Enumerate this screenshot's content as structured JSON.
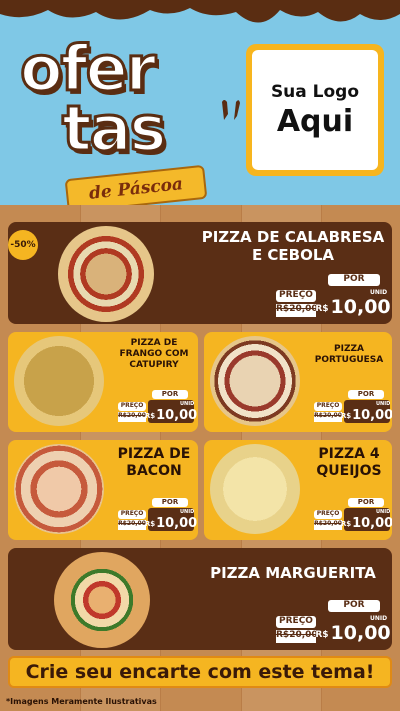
{
  "header": {
    "title_line1": "ofer",
    "title_line2": "tas",
    "subtitle": "de Páscoa",
    "logo_line1": "Sua Logo",
    "logo_line2": "Aqui"
  },
  "discount_badge": "-50%",
  "products": [
    {
      "name": "PIZZA DE CALABRESA E CEBOLA",
      "por_label": "POR",
      "preco_label": "PREÇO",
      "old_price": "R$20,00",
      "currency": "R$",
      "new_price": "10,00",
      "unit": "UNID"
    },
    {
      "name": "PIZZA DE FRANGO COM CATUPIRY",
      "por_label": "POR",
      "preco_label": "PREÇO",
      "old_price": "R$20,00",
      "currency": "R$",
      "new_price": "10,00",
      "unit": "UNID"
    },
    {
      "name": "PIZZA PORTUGUESA",
      "por_label": "POR",
      "preco_label": "PREÇO",
      "old_price": "R$20,00",
      "currency": "R$",
      "new_price": "10,00",
      "unit": "UNID"
    },
    {
      "name": "PIZZA DE BACON",
      "por_label": "POR",
      "preco_label": "PREÇO",
      "old_price": "R$20,00",
      "currency": "R$",
      "new_price": "10,00",
      "unit": "UNID"
    },
    {
      "name": "PIZZA 4 QUEIJOS",
      "por_label": "POR",
      "preco_label": "PREÇO",
      "old_price": "R$20,00",
      "currency": "R$",
      "new_price": "10,00",
      "unit": "UNID"
    },
    {
      "name": "PIZZA MARGUERITA",
      "por_label": "POR",
      "preco_label": "PREÇO",
      "old_price": "R$20,00",
      "currency": "R$",
      "new_price": "10,00",
      "unit": "UNID"
    }
  ],
  "cta": "Crie seu encarte com este tema!",
  "footnote": "*Imagens Meramente Ilustrativas",
  "colors": {
    "brown": "#5a2e15",
    "yellow": "#f5b521",
    "sky": "#7fc8e6"
  }
}
